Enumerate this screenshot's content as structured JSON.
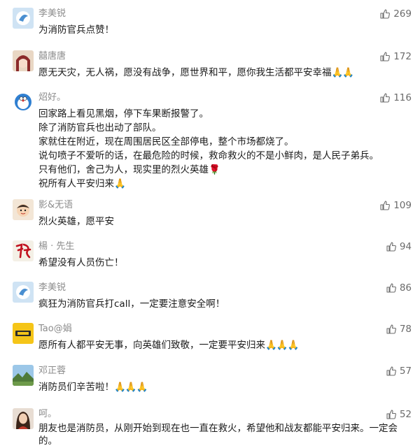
{
  "comments": [
    {
      "name": "李美锐",
      "likes": "269",
      "avatar": "avatar-blue-bird",
      "lines": [
        "为消防官兵点赞！"
      ],
      "emoji": ""
    },
    {
      "name": "囍唐唐",
      "likes": "172",
      "avatar": "avatar-anime-girl",
      "lines": [
        "愿无天灾，无人祸，愿没有战争，愿世界和平，愿你我生活都平安幸福"
      ],
      "emoji": "🙏🙏"
    },
    {
      "name": "炤好。",
      "likes": "116",
      "avatar": "avatar-doraemon",
      "lines": [
        "回家路上看见黑烟，停下车果断报警了。",
        "除了消防官兵也出动了部队。",
        "家就住在附近，现在周围居民区全部停电，整个市场都烧了。",
        "说句喷子不爱听的话，在最危险的时候，救命救火的不是小鲜肉，是人民子弟兵。",
        "只有他们，舍己为人，现实里的烈火英雄",
        "祝所有人平安归来"
      ],
      "emoji_rose": "🌹",
      "emoji": "🙏"
    },
    {
      "name": "影&无语",
      "likes": "109",
      "avatar": "avatar-cartoon-boy",
      "lines": [
        "烈火英雄，愿平安"
      ],
      "emoji": ""
    },
    {
      "name": "楊 · 先生",
      "likes": "94",
      "avatar": "avatar-calligraphy-yang",
      "lines": [
        "希望没有人员伤亡！"
      ],
      "emoji": ""
    },
    {
      "name": "李美锐",
      "likes": "86",
      "avatar": "avatar-blue-bird",
      "lines": [
        "疯狂为消防官兵打call，一定要注意安全啊！"
      ],
      "emoji": ""
    },
    {
      "name": "Tao@娟",
      "likes": "78",
      "avatar": "avatar-yellow-badge",
      "lines": [
        "愿所有人都平安无事，向英雄们致敬，一定要平安归来"
      ],
      "emoji": "🙏🙏🙏"
    },
    {
      "name": "邓正蓉",
      "likes": "57",
      "avatar": "avatar-landscape",
      "lines": [
        "消防员们辛苦啦！"
      ],
      "emoji": "🙏🙏🙏"
    },
    {
      "name": "呵。",
      "likes": "52",
      "avatar": "avatar-woman-portrait",
      "lines": [
        "朋友也是消防员，从刚开始到现在也一直在救火，希望他和战友都能平安归来。一定会",
        "的。"
      ],
      "emoji": ""
    }
  ],
  "colors": {
    "name": "#8c8c8c",
    "text": "#1a1a1a",
    "like": "#6b6b6b"
  },
  "icons": {
    "like": "thumbs-up-icon"
  }
}
